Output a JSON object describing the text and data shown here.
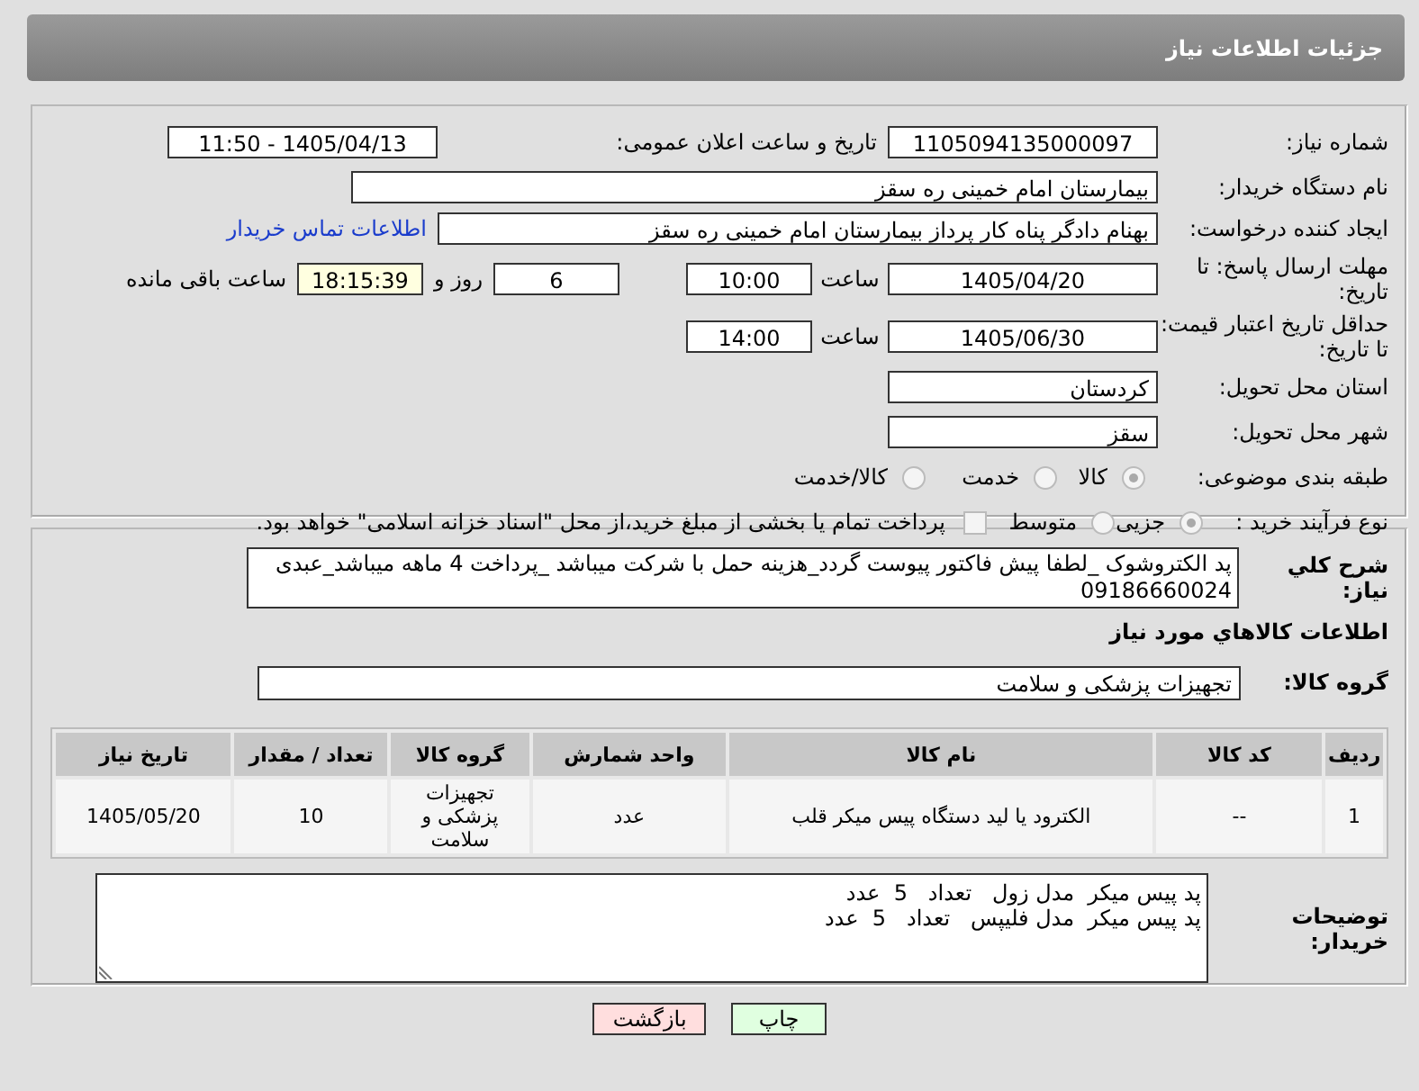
{
  "header": {
    "title": "جزئیات اطلاعات نیاز"
  },
  "details": {
    "need_number": {
      "label": "شماره نیاز:",
      "value": "1105094135000097"
    },
    "announce": {
      "label": "تاریخ و ساعت اعلان عمومی:",
      "value": "1405/04/13 - 11:50"
    },
    "buyer_org": {
      "label": "نام دستگاه خریدار:",
      "value": "بیمارستان امام خمینی  ره  سقز"
    },
    "requester": {
      "label": "ایجاد کننده درخواست:",
      "value": "بهنام دادگر پناه کار پرداز بیمارستان امام خمینی  ره  سقز",
      "link": "اطلاعات تماس خریدار"
    },
    "reply_deadline": {
      "label": "مهلت ارسال پاسخ: تا تاریخ:",
      "date": "1405/04/20",
      "time_label": "ساعت",
      "time": "10:00",
      "days": "6",
      "days_label": "روز و",
      "remaining": "18:15:39",
      "remaining_label": "ساعت باقی مانده"
    },
    "price_validity": {
      "label": "حداقل تاریخ اعتبار قیمت: تا تاریخ:",
      "date": "1405/06/30",
      "time_label": "ساعت",
      "time": "14:00"
    },
    "province": {
      "label": "استان محل تحویل:",
      "value": "کردستان"
    },
    "city": {
      "label": "شهر محل تحویل:",
      "value": "سقز"
    },
    "category": {
      "label": "طبقه بندی موضوعی:",
      "options": [
        {
          "label": "کالا",
          "selected": true
        },
        {
          "label": "خدمت",
          "selected": false
        },
        {
          "label": "کالا/خدمت",
          "selected": false
        }
      ]
    },
    "process": {
      "label": "نوع فرآیند خرید :",
      "options": [
        {
          "label": "جزیی",
          "selected": true
        },
        {
          "label": "متوسط",
          "selected": false
        }
      ],
      "payment": {
        "checked": false,
        "text": "پرداخت تمام یا بخشی از مبلغ خرید،از محل \"اسناد خزانه اسلامی\" خواهد بود."
      }
    }
  },
  "needs": {
    "description": {
      "label": "شرح کلي نياز:",
      "value": "پد الکتروشوک _لطفا پیش فاکتور پیوست گردد_هزینه حمل با شرکت میباشد _پرداخت 4 ماهه میباشد_عبدی 09186660024"
    },
    "goods_heading": "اطلاعات کالاهاي مورد نياز",
    "goods_group": {
      "label": "گروه کالا:",
      "value": "تجهیزات پزشکی و سلامت"
    },
    "table": {
      "columns": [
        "ردیف",
        "کد کالا",
        "نام کالا",
        "واحد شمارش",
        "گروه کالا",
        "تعداد / مقدار",
        "تاریخ نیاز"
      ],
      "rows": [
        [
          "1",
          "--",
          "الکترود یا لید دستگاه پیس میکر قلب",
          "عدد",
          "تجهیزات پزشکی و سلامت",
          "10",
          "1405/05/20"
        ]
      ]
    },
    "buyer_notes": {
      "label": "توضیحات خریدار:",
      "lines": [
        "پد پیس میکر  مدل زول   تعداد   5  عدد",
        "پد پیس میکر  مدل فلیپس   تعداد   5  عدد"
      ]
    }
  },
  "buttons": [
    {
      "label": "چاپ",
      "kind": "print"
    },
    {
      "label": "بازگشت",
      "kind": "back"
    }
  ]
}
